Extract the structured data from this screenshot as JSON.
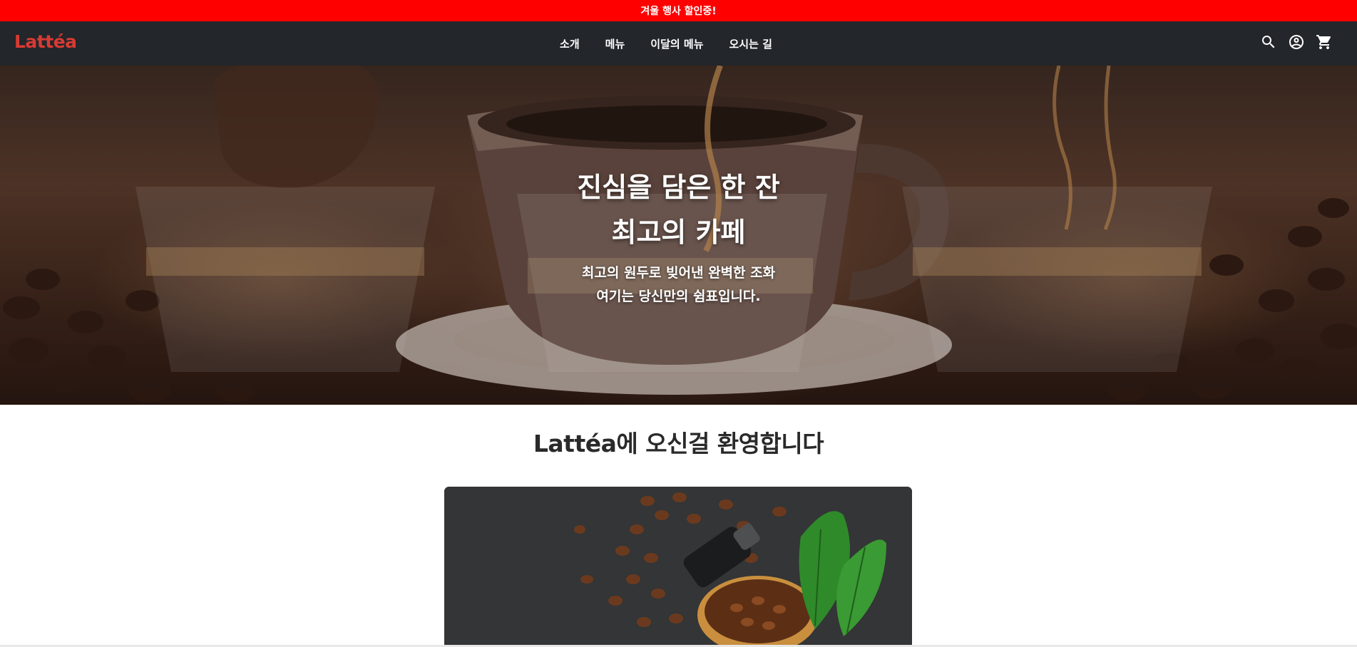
{
  "promo_bar": {
    "text": "겨울 행사 할인중!"
  },
  "header": {
    "logo": "Lattéa",
    "nav": [
      {
        "label": "소개"
      },
      {
        "label": "메뉴"
      },
      {
        "label": "이달의 메뉴"
      },
      {
        "label": "오시는 길"
      }
    ],
    "icons": [
      "search-icon",
      "account-icon",
      "cart-icon"
    ]
  },
  "hero": {
    "title_line1": "진심을 담은 한 잔",
    "title_line2": "최고의 카페",
    "subtitle_line1": "최고의 원두로 빚어낸 완벽한 조화",
    "subtitle_line2": "여기는 당신만의 쉼표입니다."
  },
  "welcome": {
    "heading": "Lattéa에 오신걸 환영합니다"
  },
  "colors": {
    "promo_bg": "#ff0000",
    "header_bg": "#23262a",
    "logo": "#d83a34"
  }
}
